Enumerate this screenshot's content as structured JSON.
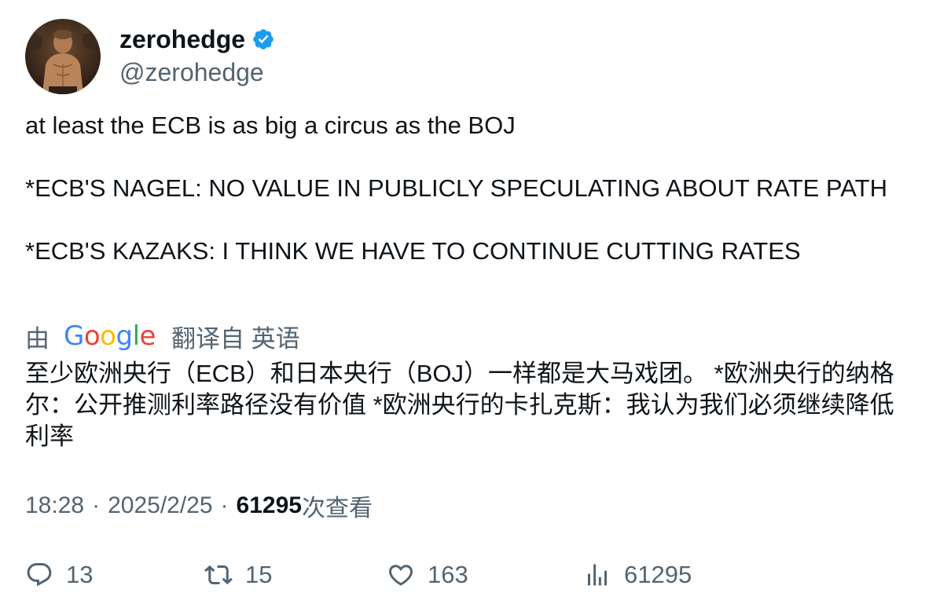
{
  "author": {
    "display_name": "zerohedge",
    "handle": "@zerohedge",
    "verified": true,
    "verified_color": "#1d9bf0"
  },
  "tweet": {
    "lines": [
      "at least the ECB is as big a circus as the BOJ",
      "*ECB'S NAGEL: NO VALUE IN PUBLICLY SPECULATING ABOUT RATE PATH",
      "*ECB'S KAZAKS: I THINK WE HAVE TO CONTINUE CUTTING RATES"
    ]
  },
  "translation": {
    "by_label": "由",
    "provider": "Google",
    "translated_from": "翻译自 英语",
    "text": "至少欧洲央行（ECB）和日本央行（BOJ）一样都是大马戏团。 *欧洲央行的纳格尔：公开推测利率路径没有价值 *欧洲央行的卡扎克斯：我认为我们必须继续降低利率"
  },
  "meta": {
    "time": "18:28",
    "separator": "·",
    "date": "2025/2/25",
    "views_count": "61295",
    "views_label": "次查看"
  },
  "actions": {
    "replies": "13",
    "retweets": "15",
    "likes": "163",
    "views": "61295"
  },
  "icons": {
    "reply": "reply-icon",
    "retweet": "retweet-icon",
    "like": "heart-icon",
    "views": "analytics-icon",
    "verified": "verified-badge-icon"
  },
  "colors": {
    "text": "#0f1419",
    "secondary": "#536471",
    "google_blue": "#4285F4",
    "google_red": "#EA4335",
    "google_yellow": "#FBBC05",
    "google_green": "#34A853"
  }
}
